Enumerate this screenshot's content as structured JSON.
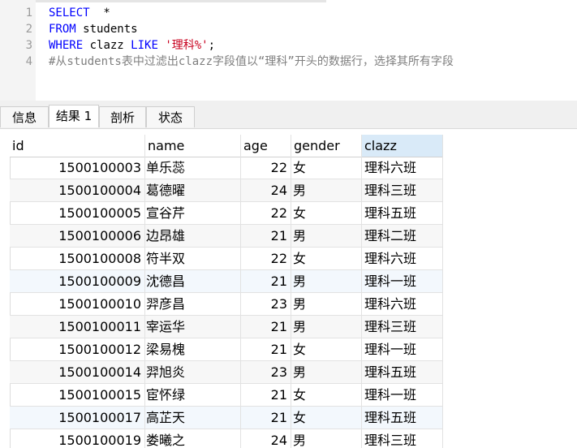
{
  "editor": {
    "lines": [
      {
        "num": "1",
        "parts": [
          {
            "t": "SELECT",
            "c": "kw"
          },
          {
            "t": "  *",
            "c": ""
          }
        ]
      },
      {
        "num": "2",
        "parts": [
          {
            "t": "FROM",
            "c": "kw"
          },
          {
            "t": " students",
            "c": ""
          }
        ]
      },
      {
        "num": "3",
        "parts": [
          {
            "t": "WHERE",
            "c": "kw"
          },
          {
            "t": " clazz ",
            "c": ""
          },
          {
            "t": "LIKE",
            "c": "kw"
          },
          {
            "t": " ",
            "c": ""
          },
          {
            "t": "'理科%'",
            "c": "str"
          },
          {
            "t": ";",
            "c": ""
          }
        ]
      },
      {
        "num": "4",
        "parts": [
          {
            "t": "#从students表中过滤出clazz字段值以“理科”开头的数据行，选择其所有字段",
            "c": "comment"
          }
        ]
      }
    ]
  },
  "tabs": [
    {
      "label": "信息",
      "active": false
    },
    {
      "label": "结果 1",
      "active": true
    },
    {
      "label": "剖析",
      "active": false
    },
    {
      "label": "状态",
      "active": false
    }
  ],
  "grid": {
    "columns": [
      "id",
      "name",
      "age",
      "gender",
      "clazz"
    ],
    "selected_column": "clazz",
    "rows": [
      [
        "1500100003",
        "单乐蕊",
        "22",
        "女",
        "理科六班"
      ],
      [
        "1500100004",
        "葛德曜",
        "24",
        "男",
        "理科三班"
      ],
      [
        "1500100005",
        "宣谷芹",
        "22",
        "女",
        "理科五班"
      ],
      [
        "1500100006",
        "边昂雄",
        "21",
        "男",
        "理科二班"
      ],
      [
        "1500100008",
        "符半双",
        "22",
        "女",
        "理科六班"
      ],
      [
        "1500100009",
        "沈德昌",
        "21",
        "男",
        "理科一班"
      ],
      [
        "1500100010",
        "羿彦昌",
        "23",
        "男",
        "理科六班"
      ],
      [
        "1500100011",
        "宰运华",
        "21",
        "男",
        "理科三班"
      ],
      [
        "1500100012",
        "梁易槐",
        "21",
        "女",
        "理科一班"
      ],
      [
        "1500100014",
        "羿旭炎",
        "23",
        "男",
        "理科五班"
      ],
      [
        "1500100015",
        "宦怀绿",
        "21",
        "女",
        "理科一班"
      ],
      [
        "1500100017",
        "高芷天",
        "21",
        "女",
        "理科五班"
      ],
      [
        "1500100019",
        "娄曦之",
        "24",
        "男",
        "理科三班"
      ]
    ]
  },
  "colors": {
    "keyword": "#0000ff",
    "string": "#c8001e",
    "comment": "#7f7f7f",
    "selected_header": "#d9eaf8"
  }
}
